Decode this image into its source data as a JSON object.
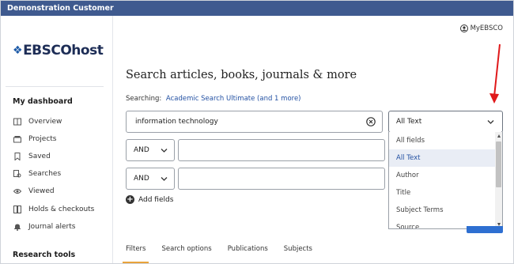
{
  "window": {
    "title": "Demonstration Customer"
  },
  "logo": {
    "text": "EBSCOhost"
  },
  "sidebar": {
    "dashboard_title": "My dashboard",
    "items": [
      {
        "label": "Overview",
        "icon": "overview-icon"
      },
      {
        "label": "Projects",
        "icon": "projects-icon"
      },
      {
        "label": "Saved",
        "icon": "bookmark-icon"
      },
      {
        "label": "Searches",
        "icon": "search-history-icon"
      },
      {
        "label": "Viewed",
        "icon": "eye-icon"
      },
      {
        "label": "Holds & checkouts",
        "icon": "holds-icon"
      },
      {
        "label": "Journal alerts",
        "icon": "bell-icon"
      }
    ],
    "research_title": "Research tools"
  },
  "header": {
    "account_label": "MyEBSCO",
    "account_icon": "user-icon"
  },
  "main": {
    "heading": "Search articles, books, journals & more",
    "searching_label": "Searching:",
    "searching_link": "Academic Search Ultimate (and 1 more)",
    "search_value": "information technology",
    "rows": [
      {
        "operator": "AND",
        "value": ""
      },
      {
        "operator": "AND",
        "value": ""
      }
    ],
    "add_fields_label": "Add fields",
    "field_select": {
      "value": "All Text",
      "options": [
        "All fields",
        "All Text",
        "Author",
        "Title",
        "Subject Terms",
        "Source"
      ],
      "selected_index": 1
    },
    "tabs": [
      "Filters",
      "Search options",
      "Publications",
      "Subjects"
    ],
    "active_tab": "Filters"
  },
  "colors": {
    "topbar": "#3f5a8f",
    "link": "#2351a3",
    "accent_tab": "#e8a33a",
    "arrow": "#e0191b"
  }
}
